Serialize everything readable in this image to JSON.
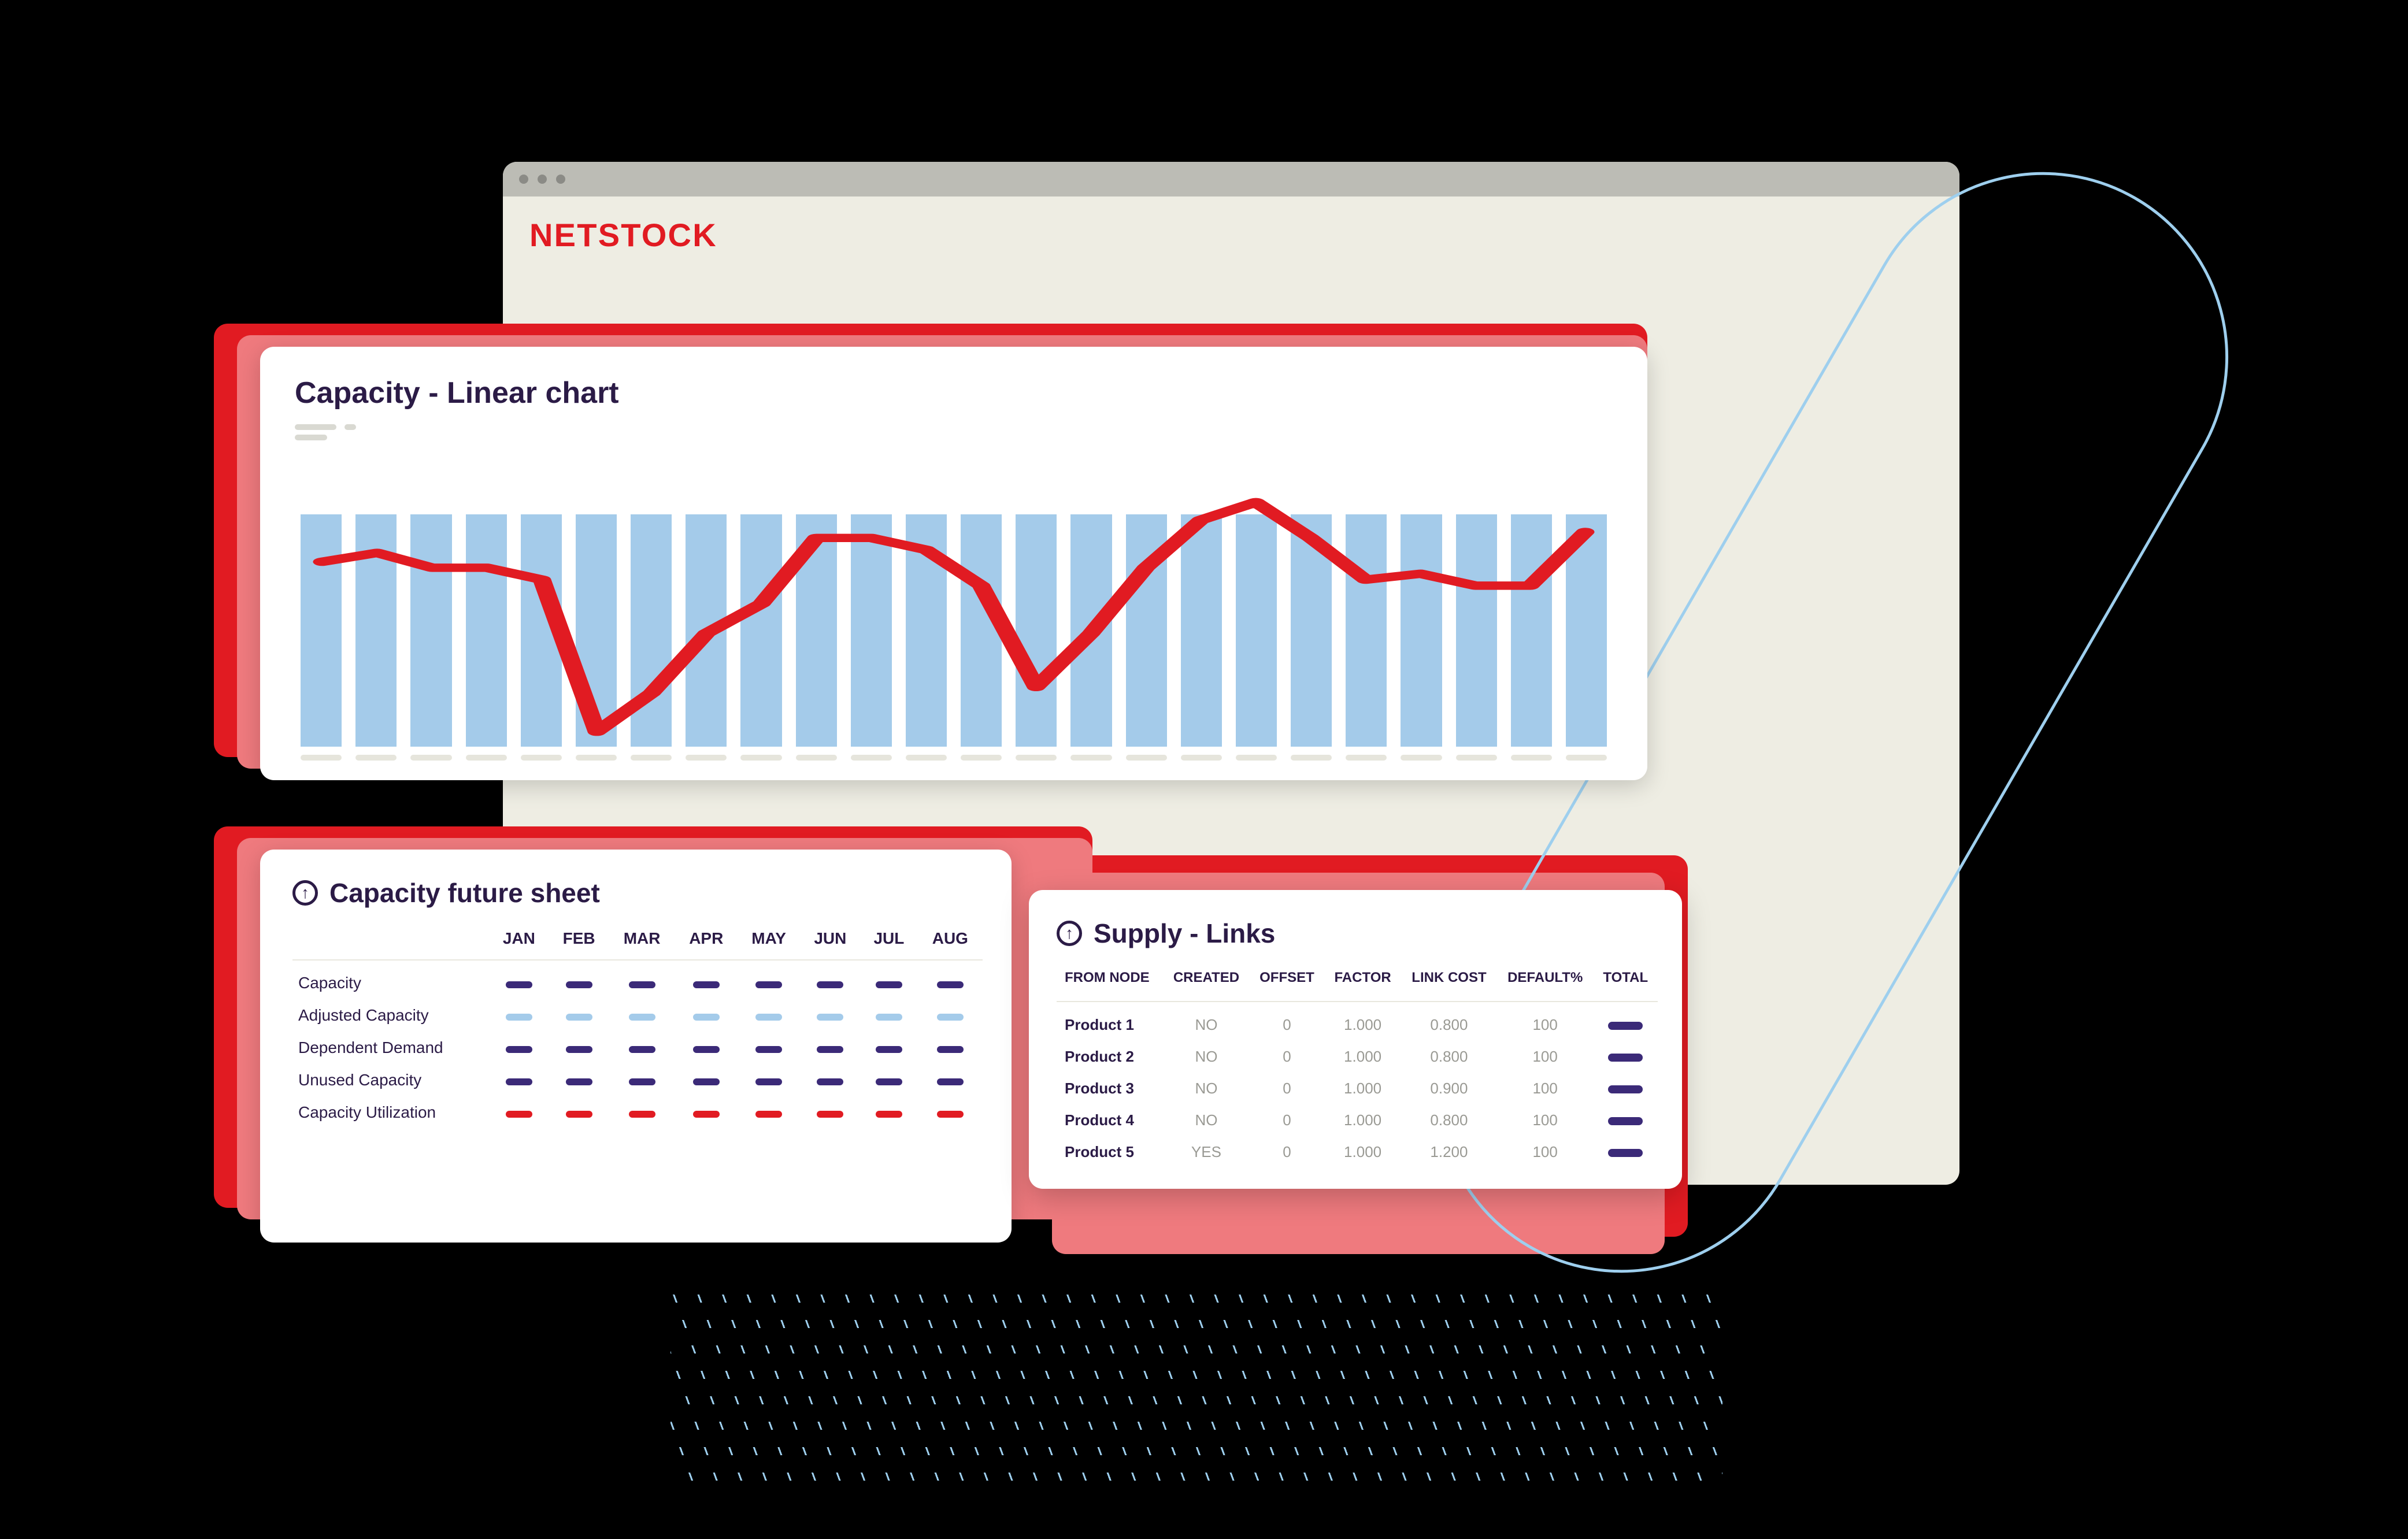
{
  "brand": "NETSTOCK",
  "colors": {
    "red": "#e11b22",
    "purple": "#3b2a78",
    "blue": "#a4cbea",
    "lightblue_stroke": "#9ecfee"
  },
  "chart_card": {
    "title": "Capacity - Linear chart"
  },
  "chart_data": {
    "type": "bar+line",
    "categories_count": 24,
    "bar_value_uniform": 78,
    "series": [
      {
        "name": "line",
        "values_pct_of_height": [
          38,
          35,
          40,
          40,
          44,
          95,
          82,
          62,
          52,
          30,
          30,
          34,
          46,
          80,
          62,
          40,
          24,
          18,
          30,
          44,
          42,
          46,
          46,
          28
        ]
      }
    ],
    "ylim_pct": [
      0,
      100
    ]
  },
  "sheet_card": {
    "title": "Capacity future sheet",
    "months": [
      "JAN",
      "FEB",
      "MAR",
      "APR",
      "MAY",
      "JUN",
      "JUL",
      "AUG"
    ],
    "rows": [
      {
        "label": "Capacity",
        "color": "purple"
      },
      {
        "label": "Adjusted Capacity",
        "color": "blue"
      },
      {
        "label": "Dependent Demand",
        "color": "purple"
      },
      {
        "label": "Unused Capacity",
        "color": "purple"
      },
      {
        "label": "Capacity Utilization",
        "color": "red"
      }
    ]
  },
  "supply_card": {
    "title": "Supply - Links",
    "columns": [
      "FROM NODE",
      "CREATED",
      "OFFSET",
      "FACTOR",
      "LINK COST",
      "DEFAULT%",
      "TOTAL"
    ],
    "rows": [
      {
        "name": "Product 1",
        "created": "NO",
        "offset": "0",
        "factor": "1.000",
        "link_cost": "0.800",
        "default": "100"
      },
      {
        "name": "Product 2",
        "created": "NO",
        "offset": "0",
        "factor": "1.000",
        "link_cost": "0.800",
        "default": "100"
      },
      {
        "name": "Product 3",
        "created": "NO",
        "offset": "0",
        "factor": "1.000",
        "link_cost": "0.900",
        "default": "100"
      },
      {
        "name": "Product 4",
        "created": "NO",
        "offset": "0",
        "factor": "1.000",
        "link_cost": "0.800",
        "default": "100"
      },
      {
        "name": "Product 5",
        "created": "YES",
        "offset": "0",
        "factor": "1.000",
        "link_cost": "1.200",
        "default": "100"
      }
    ]
  }
}
